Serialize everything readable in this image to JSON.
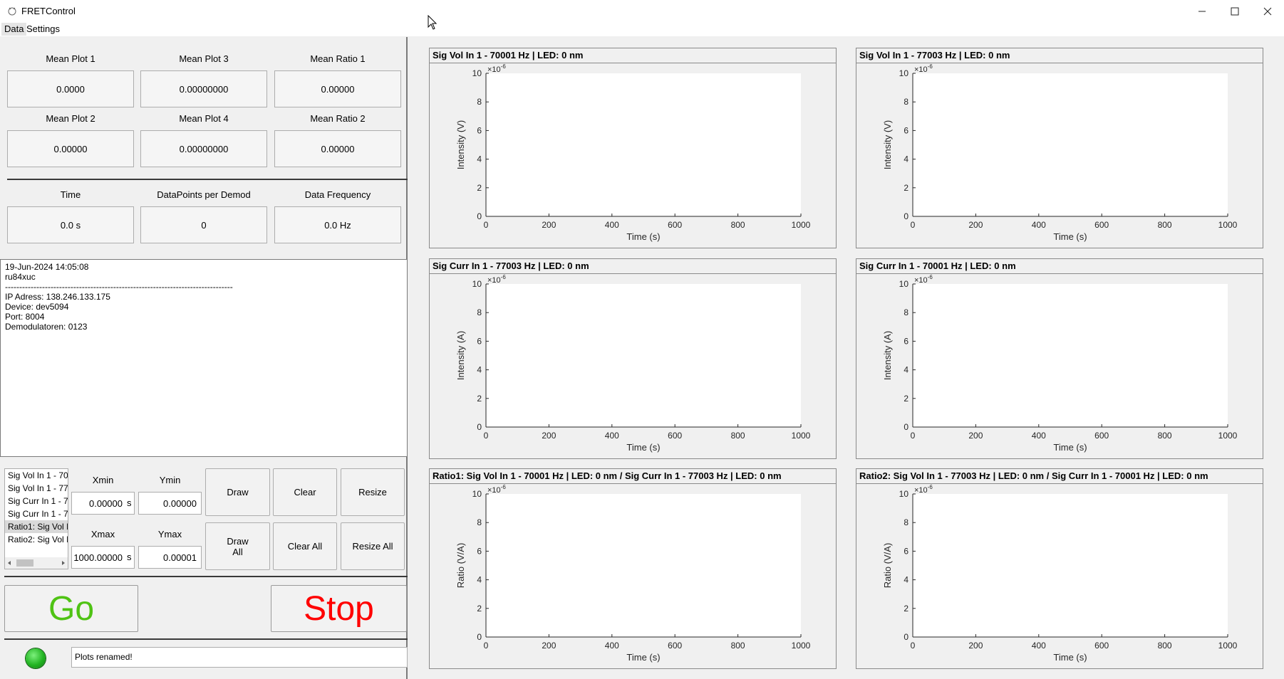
{
  "window": {
    "title": "FRETControl"
  },
  "menu": [
    "Data",
    "Settings"
  ],
  "stats": [
    {
      "label": "Mean Plot 1",
      "value": "0.0000"
    },
    {
      "label": "Mean Plot 3",
      "value": "0.00000000"
    },
    {
      "label": "Mean Ratio 1",
      "value": "0.00000"
    },
    {
      "label": "Mean Plot 2",
      "value": "0.00000"
    },
    {
      "label": "Mean Plot 4",
      "value": "0.00000000"
    },
    {
      "label": "Mean Ratio 2",
      "value": "0.00000"
    }
  ],
  "info": [
    {
      "label": "Time",
      "value": "0.0  s"
    },
    {
      "label": "DataPoints per Demod",
      "value": "0"
    },
    {
      "label": "Data Frequency",
      "value": "0.0 Hz"
    }
  ],
  "log": [
    "19-Jun-2024 14:05:08",
    "ru84xuc",
    "--------------------------------------------------------------------------------",
    "IP Adress: 138.246.133.175",
    "Device: dev5094",
    "Port: 8004",
    "Demodulatoren: 0123"
  ],
  "plot_list": {
    "items": [
      "Sig Vol In 1 - 70",
      "Sig Vol In 1 - 77",
      "Sig Curr In 1 - 7",
      "Sig Curr In 1 - 7",
      "Ratio1: Sig Vol I",
      "Ratio2: Sig Vol I"
    ],
    "selected_index": 4
  },
  "axes_controls": {
    "xmin": {
      "label": "Xmin",
      "value": "0.00000",
      "unit": "s"
    },
    "ymin": {
      "label": "Ymin",
      "value": "0.00000"
    },
    "xmax": {
      "label": "Xmax",
      "value": "1000.00000",
      "unit": "s"
    },
    "ymax": {
      "label": "Ymax",
      "value": "0.00001"
    }
  },
  "buttons": {
    "draw": "Draw",
    "clear": "Clear",
    "resize": "Resize",
    "draw_all": "Draw All",
    "clear_all": "Clear All",
    "resize_all": "Resize All",
    "go": "Go",
    "stop": "Stop"
  },
  "colors": {
    "go": "#4fc314",
    "stop": "#ff0000",
    "led": "#22b422"
  },
  "status": {
    "message": "Plots renamed!"
  },
  "chart_data": [
    {
      "type": "line",
      "title": "Sig Vol In 1 - 70001 Hz | LED: 0 nm",
      "xlabel": "Time (s)",
      "ylabel": "Intensity (V)",
      "xlim": [
        0,
        1000
      ],
      "ylim": [
        0,
        10
      ],
      "y_exponent": "-6",
      "xticks": [
        "0",
        "200",
        "400",
        "600",
        "800",
        "1000"
      ],
      "yticks": [
        "0",
        "2",
        "4",
        "6",
        "8",
        "10"
      ],
      "series": []
    },
    {
      "type": "line",
      "title": "Sig Vol In 1 - 77003 Hz | LED: 0 nm",
      "xlabel": "Time (s)",
      "ylabel": "Intensity (V)",
      "xlim": [
        0,
        1000
      ],
      "ylim": [
        0,
        10
      ],
      "y_exponent": "-6",
      "xticks": [
        "0",
        "200",
        "400",
        "600",
        "800",
        "1000"
      ],
      "yticks": [
        "0",
        "2",
        "4",
        "6",
        "8",
        "10"
      ],
      "series": []
    },
    {
      "type": "line",
      "title": "Sig Curr In 1 - 77003 Hz | LED: 0 nm",
      "xlabel": "Time (s)",
      "ylabel": "Intensity (A)",
      "xlim": [
        0,
        1000
      ],
      "ylim": [
        0,
        10
      ],
      "y_exponent": "-6",
      "xticks": [
        "0",
        "200",
        "400",
        "600",
        "800",
        "1000"
      ],
      "yticks": [
        "0",
        "2",
        "4",
        "6",
        "8",
        "10"
      ],
      "series": []
    },
    {
      "type": "line",
      "title": "Sig Curr In 1 - 70001 Hz | LED: 0 nm",
      "xlabel": "Time (s)",
      "ylabel": "Intensity (A)",
      "xlim": [
        0,
        1000
      ],
      "ylim": [
        0,
        10
      ],
      "y_exponent": "-6",
      "xticks": [
        "0",
        "200",
        "400",
        "600",
        "800",
        "1000"
      ],
      "yticks": [
        "0",
        "2",
        "4",
        "6",
        "8",
        "10"
      ],
      "series": []
    },
    {
      "type": "line",
      "title": "Ratio1: Sig Vol In 1 - 70001 Hz | LED: 0 nm / Sig Curr In 1 - 77003 Hz | LED: 0 nm",
      "xlabel": "Time (s)",
      "ylabel": "Ratio (V/A)",
      "xlim": [
        0,
        1000
      ],
      "ylim": [
        0,
        10
      ],
      "y_exponent": "-6",
      "xticks": [
        "0",
        "200",
        "400",
        "600",
        "800",
        "1000"
      ],
      "yticks": [
        "0",
        "2",
        "4",
        "6",
        "8",
        "10"
      ],
      "series": []
    },
    {
      "type": "line",
      "title": "Ratio2: Sig Vol In 1 - 77003 Hz | LED: 0 nm / Sig Curr In 1 - 70001 Hz | LED: 0 nm",
      "xlabel": "Time (s)",
      "ylabel": "Ratio (V/A)",
      "xlim": [
        0,
        1000
      ],
      "ylim": [
        0,
        10
      ],
      "y_exponent": "-6",
      "xticks": [
        "0",
        "200",
        "400",
        "600",
        "800",
        "1000"
      ],
      "yticks": [
        "0",
        "2",
        "4",
        "6",
        "8",
        "10"
      ],
      "series": []
    }
  ]
}
